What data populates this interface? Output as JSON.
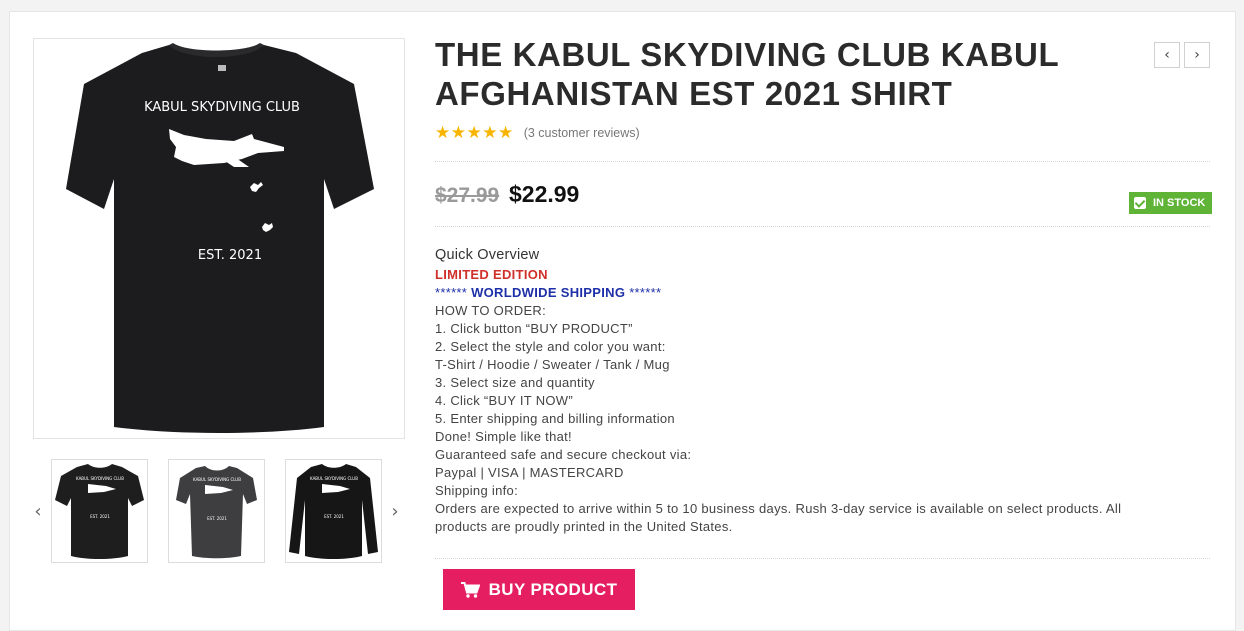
{
  "product": {
    "title": "THE KABUL SKYDIVING CLUB KABUL AFGHANISTAN EST 2021 SHIRT",
    "rating_stars": "★★★★★",
    "rating_value": 5,
    "reviews_text": "(3 customer reviews)",
    "price_old": "$27.99",
    "price_new": "$22.99",
    "stock_label": "IN STOCK"
  },
  "image": {
    "shirt_text_top": "KABUL SKYDIVING CLUB",
    "shirt_text_bottom": "EST. 2021"
  },
  "thumbnails": [
    {
      "name": "t-shirt-black",
      "color": "#1e1e1e"
    },
    {
      "name": "t-shirt-women-gray",
      "color": "#3e3e40"
    },
    {
      "name": "long-sleeve-black",
      "color": "#161616"
    }
  ],
  "overview": {
    "heading": "Quick Overview",
    "limited": "LIMITED EDITION",
    "shipping_ast": "******",
    "shipping_text": "WORLDWIDE SHIPPING",
    "lines": [
      "HOW TO ORDER:",
      "1. Click button “BUY PRODUCT”",
      "2. Select the style and color you want:",
      "T-Shirt / Hoodie / Sweater / Tank / Mug",
      "3. Select size and quantity",
      "4. Click “BUY IT NOW”",
      "5. Enter shipping and billing information",
      "Done! Simple like that!",
      "Guaranteed safe and secure checkout via:",
      "Paypal | VISA | MASTERCARD",
      "Shipping info:",
      "Orders are expected to arrive within 5 to 10 business days. Rush 3-day service is available on select products. All products are proudly printed in the United States."
    ]
  },
  "buttons": {
    "buy": "BUY PRODUCT",
    "nav_prev": "‹",
    "nav_next": "›",
    "thumb_prev": "‹",
    "thumb_next": "›"
  },
  "colors": {
    "accent": "#e41e61",
    "stock": "#5fb336",
    "limited": "#d0302a",
    "shipping": "#1e2fa8",
    "stars": "#f7b500"
  },
  "icons": {
    "cart": "shopping-cart-icon",
    "check": "check-icon",
    "star": "star-icon"
  }
}
